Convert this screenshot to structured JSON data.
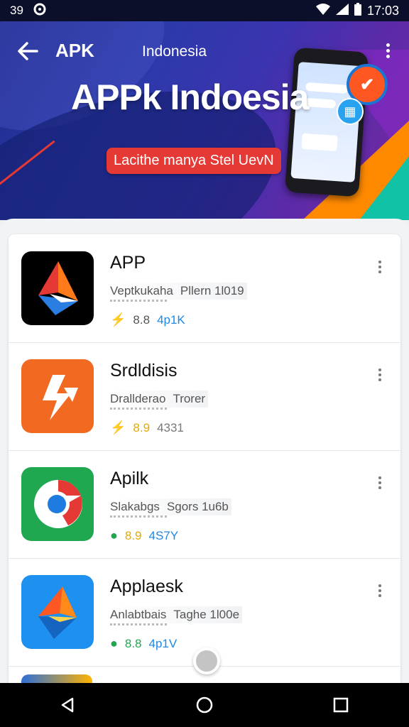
{
  "status_bar": {
    "left_text": "39",
    "time": "17:03"
  },
  "app_bar": {
    "title": "APK",
    "region": "Indonesia"
  },
  "hero": {
    "title": "APPk Indoesia",
    "badge": "Lacithe manya Stel UevN"
  },
  "apps": [
    {
      "name": "APP",
      "sub1": "Veptkukaha",
      "sub2": "Pllern 1l019",
      "rating": "8.8",
      "size": "4p1K",
      "icon": "red-blue-diamond-icon"
    },
    {
      "name": "Srdldisis",
      "sub1": "Drallderao",
      "sub2": "Trorer",
      "rating": "8.9",
      "size": "4331",
      "icon": "orange-lightning-icon"
    },
    {
      "name": "Apilk",
      "sub1": "Slakabgs",
      "sub2": "Sgors 1u6b",
      "rating": "8.9",
      "size": "4S7Y",
      "icon": "chrome-like-icon"
    },
    {
      "name": "Applaesk",
      "sub1": "Anlabtbais",
      "sub2": "Taghe 1l00e",
      "rating": "8.8",
      "size": "4p1V",
      "icon": "blue-orange-diamond-icon"
    }
  ],
  "colors": {
    "accent_red": "#e53935",
    "size_blue": "#1e88e5"
  }
}
